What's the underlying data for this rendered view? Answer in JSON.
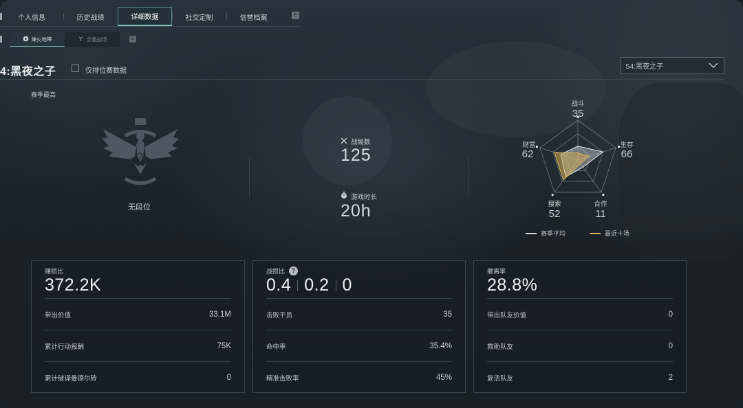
{
  "tabs": [
    "个人信息",
    "历史战绩",
    "详细数据",
    "社交定制",
    "信誉档案"
  ],
  "active_tab": "详细数据",
  "tab_shortcut": "E",
  "subtabs": [
    {
      "label": "烽火地带",
      "icon": "flame-icon",
      "active": true
    },
    {
      "label": "全面战场",
      "icon": "antenna-icon",
      "active": false
    }
  ],
  "subtab_shortcut": "D",
  "season": {
    "title": "4:黑夜之子",
    "ranked_only_label": "仅排位赛数据",
    "dropdown_value": "S4:黑夜之子"
  },
  "season_best_label": "赛季最高",
  "rank": {
    "label": "无段位",
    "icon": "eagle-rank-emblem-icon"
  },
  "matches": {
    "label": "战局数",
    "value": "125",
    "icon": "crossed-swords-icon"
  },
  "playtime": {
    "label": "游戏时长",
    "value": "20h",
    "icon": "stopwatch-icon"
  },
  "radar": {
    "axes": [
      {
        "label": "战斗",
        "value": "35"
      },
      {
        "label": "生存",
        "value": "66"
      },
      {
        "label": "合作",
        "value": "11"
      },
      {
        "label": "搜索",
        "value": "52"
      },
      {
        "label": "财富",
        "value": "62"
      }
    ],
    "season_avg_fraction": [
      0.35,
      0.66,
      0.22,
      0.52,
      0.45
    ],
    "recent_fraction": [
      0.18,
      0.3,
      0.11,
      0.62,
      0.62
    ],
    "legend": {
      "season_avg": "赛季平均",
      "recent": "最近十场"
    },
    "colors": {
      "season_avg": "#d8dde0",
      "recent": "#d8b25a"
    }
  },
  "cards": {
    "profit": {
      "title": "赚损比",
      "value": "372.2K",
      "rows": [
        {
          "label": "带出价值",
          "value": "33.1M"
        },
        {
          "label": "累计行动报酬",
          "value": "75K"
        },
        {
          "label": "累计破译曼德尔砖",
          "value": "0"
        }
      ]
    },
    "combat": {
      "title": "战损比",
      "values": [
        "0.4",
        "0.2",
        "0"
      ],
      "rows": [
        {
          "label": "击败干员",
          "value": "35"
        },
        {
          "label": "命中率",
          "value": "35.4%"
        },
        {
          "label": "精准击败率",
          "value": "45%"
        }
      ]
    },
    "extract": {
      "title": "撤离率",
      "value": "28.8%",
      "rows": [
        {
          "label": "带出队友价值",
          "value": "0"
        },
        {
          "label": "救助队友",
          "value": "0"
        },
        {
          "label": "复活队友",
          "value": "2"
        }
      ]
    }
  }
}
